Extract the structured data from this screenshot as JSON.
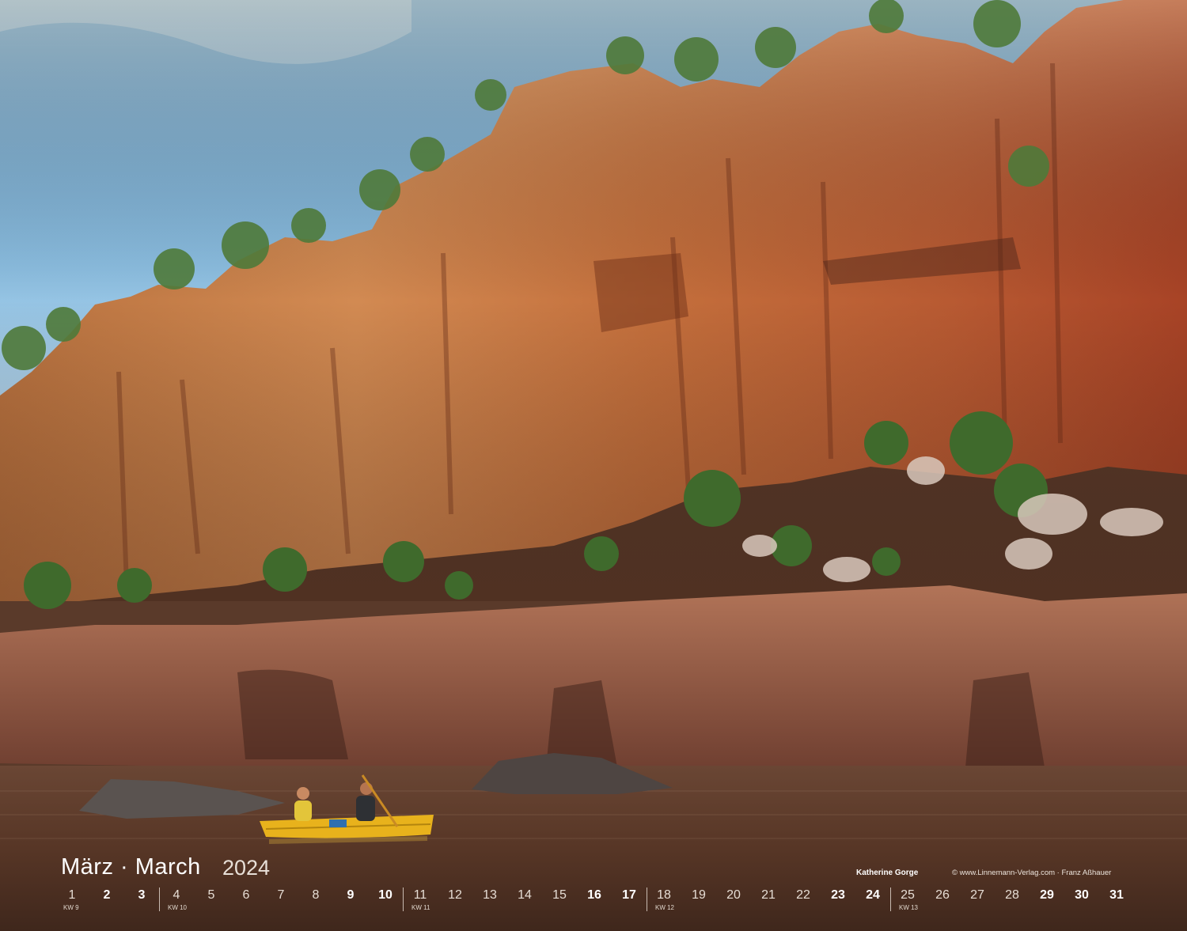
{
  "calendar": {
    "month": "März · March",
    "year": "2024",
    "location": "Katherine Gorge",
    "credit": "© www.Linnemann-Verlag.com · Franz Aßhauer",
    "days": [
      {
        "n": "1",
        "we": false
      },
      {
        "n": "2",
        "we": true
      },
      {
        "n": "3",
        "we": true
      },
      {
        "n": "4",
        "we": false
      },
      {
        "n": "5",
        "we": false
      },
      {
        "n": "6",
        "we": false
      },
      {
        "n": "7",
        "we": false
      },
      {
        "n": "8",
        "we": false
      },
      {
        "n": "9",
        "we": true
      },
      {
        "n": "10",
        "we": true
      },
      {
        "n": "11",
        "we": false
      },
      {
        "n": "12",
        "we": false
      },
      {
        "n": "13",
        "we": false
      },
      {
        "n": "14",
        "we": false
      },
      {
        "n": "15",
        "we": false
      },
      {
        "n": "16",
        "we": true
      },
      {
        "n": "17",
        "we": true
      },
      {
        "n": "18",
        "we": false
      },
      {
        "n": "19",
        "we": false
      },
      {
        "n": "20",
        "we": false
      },
      {
        "n": "21",
        "we": false
      },
      {
        "n": "22",
        "we": false
      },
      {
        "n": "23",
        "we": true
      },
      {
        "n": "24",
        "we": true
      },
      {
        "n": "25",
        "we": false
      },
      {
        "n": "26",
        "we": false
      },
      {
        "n": "27",
        "we": false
      },
      {
        "n": "28",
        "we": false
      },
      {
        "n": "29",
        "we": true
      },
      {
        "n": "30",
        "we": true
      },
      {
        "n": "31",
        "we": true
      }
    ],
    "weeks": [
      "KW 9",
      "KW 10",
      "KW 11",
      "KW 12",
      "KW 13"
    ]
  },
  "colors": {
    "sky": "#6fa9d6",
    "cliff": "#c8683a",
    "water": "#5b3a28",
    "canoe": "#e8b21c"
  }
}
